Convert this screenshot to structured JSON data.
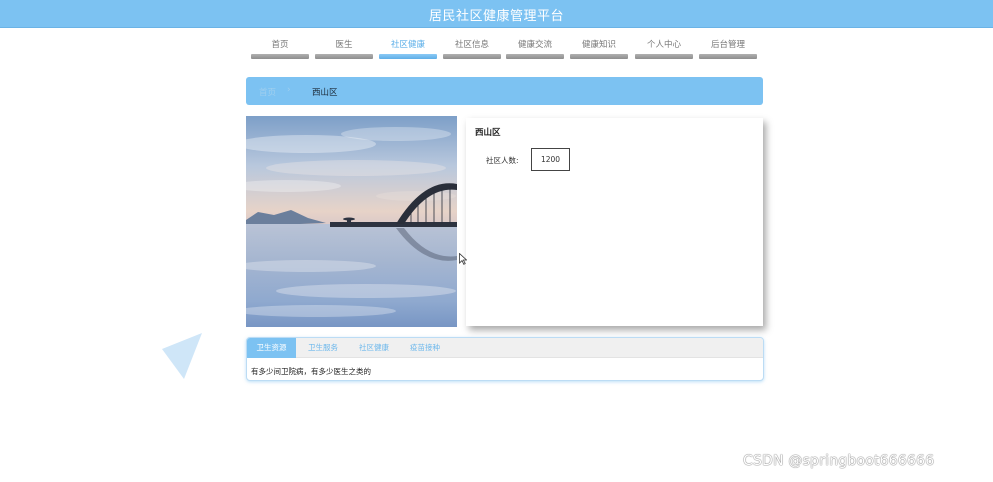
{
  "header": {
    "title": "居民社区健康管理平台"
  },
  "nav": {
    "items": [
      {
        "label": "首页"
      },
      {
        "label": "医生"
      },
      {
        "label": "社区健康"
      },
      {
        "label": "社区信息"
      },
      {
        "label": "健康交流"
      },
      {
        "label": "健康知识"
      },
      {
        "label": "个人中心"
      },
      {
        "label": "后台管理"
      }
    ],
    "active_index": 2
  },
  "breadcrumb": {
    "home": "首页",
    "separator": "›",
    "current": "西山区"
  },
  "community": {
    "name": "西山区",
    "population_label": "社区人数:",
    "population_value": "1200"
  },
  "tabs": {
    "items": [
      {
        "label": "卫生资源"
      },
      {
        "label": "卫生服务"
      },
      {
        "label": "社区健康"
      },
      {
        "label": "疫苗接种"
      }
    ],
    "active_index": 0,
    "content": "有多少间卫院病，有多少医生之类的"
  },
  "watermark": "CSDN @springboot666666",
  "colors": {
    "accent": "#7cc2f2",
    "accent_dark": "#5aaee8"
  }
}
